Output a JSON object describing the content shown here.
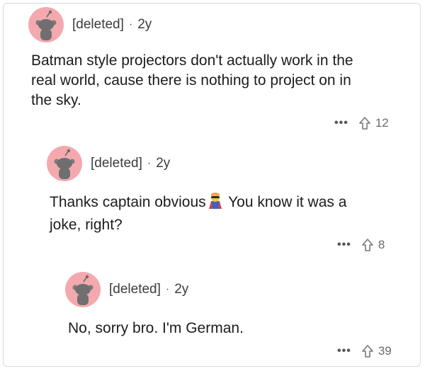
{
  "comments": [
    {
      "author": "[deleted]",
      "separator": "·",
      "age": "2y",
      "text": "Batman style projectors don't actually work in the\nreal world, cause there is nothing to project on in\nthe sky.",
      "more": "•••",
      "upvotes": "12"
    },
    {
      "author": "[deleted]",
      "separator": "·",
      "age": "2y",
      "text_before": "Thanks captain obvious",
      "emoji": "superhero-emoji",
      "text_after": " You know it was a\njoke, right?",
      "more": "•••",
      "upvotes": "8"
    },
    {
      "author": "[deleted]",
      "separator": "·",
      "age": "2y",
      "text": "No, sorry bro. I'm German.",
      "more": "•••",
      "upvotes": "39"
    }
  ],
  "colors": {
    "avatar_bg": "#f4a9ae",
    "text": "#1c1c1c",
    "meta": "#3c3c3c",
    "muted": "#6a6a6a"
  }
}
